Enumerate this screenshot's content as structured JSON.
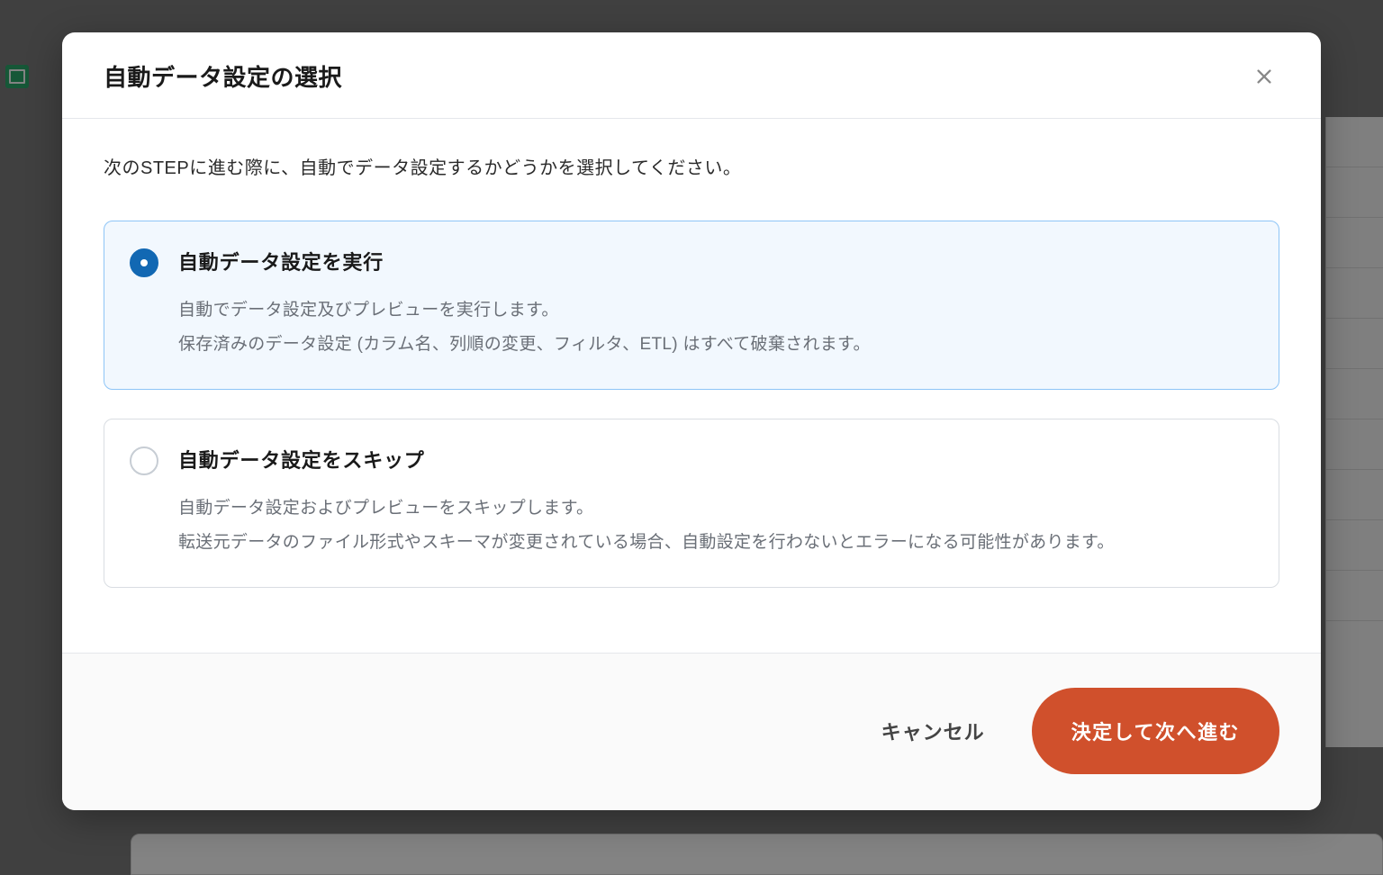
{
  "modal": {
    "title": "自動データ設定の選択",
    "instruction": "次のSTEPに進む際に、自動でデータ設定するかどうかを選択してください。",
    "options": [
      {
        "title": "自動データ設定を実行",
        "desc_line1": "自動でデータ設定及びプレビューを実行します。",
        "desc_line2": "保存済みのデータ設定 (カラム名、列順の変更、フィルタ、ETL) はすべて破棄されます。",
        "selected": true
      },
      {
        "title": "自動データ設定をスキップ",
        "desc_line1": "自動データ設定およびプレビューをスキップします。",
        "desc_line2": "転送元データのファイル形式やスキーマが変更されている場合、自動設定を行わないとエラーになる可能性があります。",
        "selected": false
      }
    ],
    "footer": {
      "cancel": "キャンセル",
      "confirm": "決定して次へ進む"
    }
  }
}
